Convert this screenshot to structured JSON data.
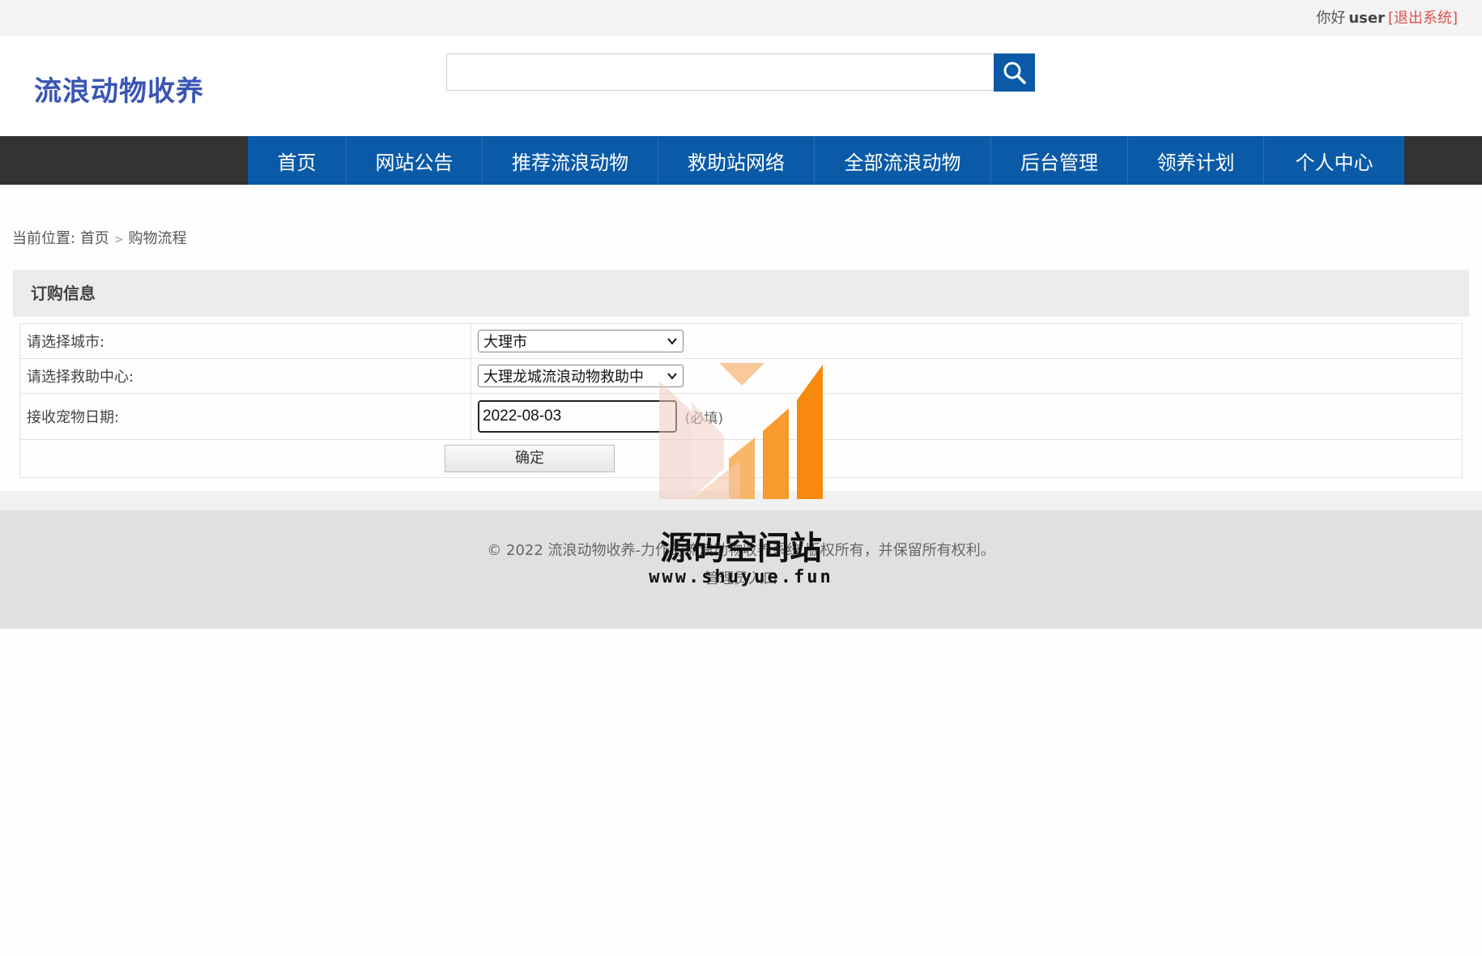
{
  "topbar": {
    "greeting": "你好",
    "username": "user",
    "logout": "[退出系统]"
  },
  "header": {
    "logo": "流浪动物收养",
    "search_value": "",
    "search_icon": "search-icon"
  },
  "nav": [
    {
      "label": "首页"
    },
    {
      "label": "网站公告"
    },
    {
      "label": "推荐流浪动物"
    },
    {
      "label": "救助站网络"
    },
    {
      "label": "全部流浪动物"
    },
    {
      "label": "后台管理"
    },
    {
      "label": "领养计划"
    },
    {
      "label": "个人中心"
    }
  ],
  "breadcrumb": {
    "prefix": "当前位置:",
    "home": "首页",
    "current": "购物流程"
  },
  "panel": {
    "title": "订购信息"
  },
  "form": {
    "city_label": "请选择城市:",
    "city_value": "大理市",
    "center_label": "请选择救助中心:",
    "center_value": "大理龙城流浪动物救助中",
    "date_label": "接收宠物日期:",
    "date_value": "2022-08-03",
    "date_hint": "(必填)",
    "confirm": "确定"
  },
  "footer": {
    "copyright": "© 2022 流浪动物收养-力作的流浪动物收养系统 版权所有，并保留所有权利。",
    "admin": "管理员入口"
  },
  "watermark": {
    "title": "源码空间站",
    "url": "www.shuyue.fun"
  }
}
